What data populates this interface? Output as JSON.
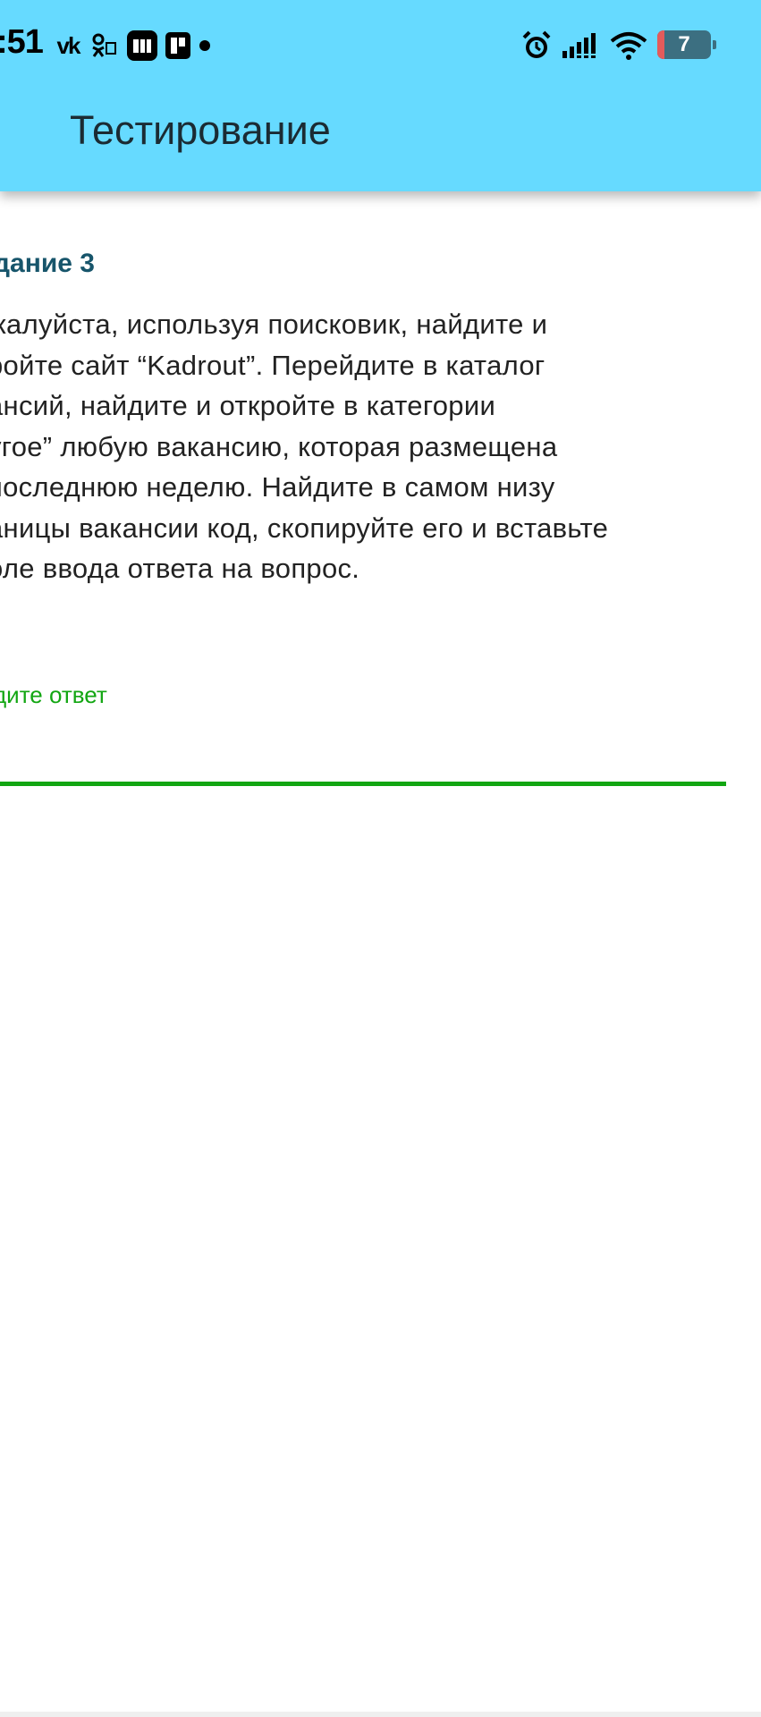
{
  "status_bar": {
    "time": ":51",
    "vk_label": "vk",
    "battery_level": "7"
  },
  "app_bar": {
    "title": "Тестирование"
  },
  "task": {
    "title": "дание 3",
    "text": "жалуйста, используя поисковик, найдите и\nройте сайт “Kadrout”. Перейдите в каталог\nансий, найдите и откройте в категории\nугое” любую вакансию, которая размещена\nпоследнюю неделю. Найдите в самом низу\nаницы вакансии код, скопируйте его и вставьте\nоле ввода ответа на вопрос."
  },
  "answer": {
    "label": "дите ответ",
    "value": ""
  },
  "colors": {
    "header": "#66daff",
    "task_title": "#17556b",
    "accent_green": "#12a612"
  },
  "icons": [
    "vk-icon",
    "ok-icon",
    "app-badge-icon",
    "app-badge2-icon",
    "notification-dot-icon",
    "alarm-icon",
    "signal-icon",
    "wifi-icon",
    "battery-icon"
  ]
}
